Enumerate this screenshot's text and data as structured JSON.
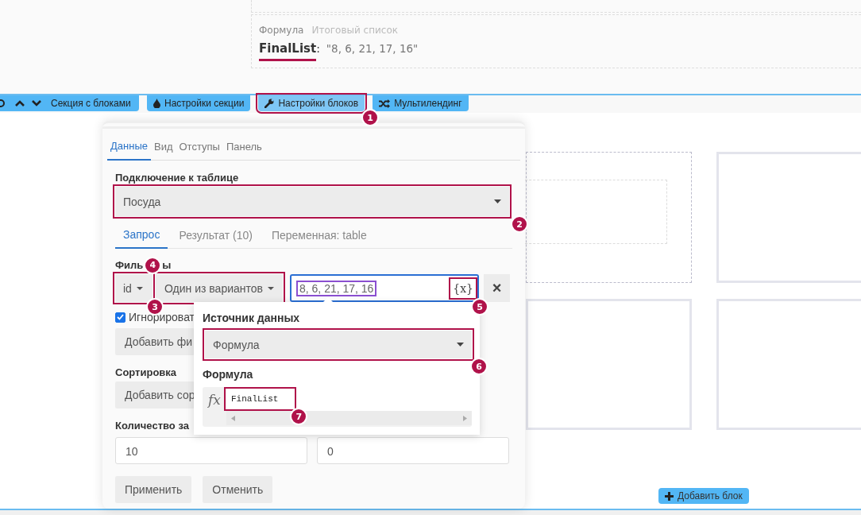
{
  "preview": {
    "source_label": "Формула",
    "title": "Итоговый список",
    "variable": "FinalList",
    "separator": ":",
    "value": "\"8, 6, 21, 17, 16\"",
    "underlined": true
  },
  "section_bar": {
    "label": "Секция с блоками"
  },
  "toolbar_buttons": [
    {
      "label": "Настройки секции"
    },
    {
      "label": "Настройки блоков",
      "callout": "1"
    },
    {
      "label": "Мультилендинг"
    }
  ],
  "panel": {
    "tabs": [
      {
        "label": "Данные",
        "selected": true
      },
      {
        "label": "Вид",
        "selected": false
      },
      {
        "label": "Отступы",
        "selected": false
      },
      {
        "label": "Панель",
        "selected": false
      }
    ],
    "connection": {
      "label": "Подключение к таблице",
      "value": "Посуда",
      "callout": "2"
    },
    "subtabs": [
      {
        "label": "Запрос",
        "selected": true
      },
      {
        "label": "Результат (10)",
        "selected": false
      },
      {
        "label": "Переменная: table",
        "selected": false
      }
    ],
    "filters": {
      "label_parts": [
        "Филь",
        "ы"
      ],
      "field": {
        "value": "id",
        "callout": "4"
      },
      "operator": {
        "value": "Один из вариантов",
        "callout": "3"
      },
      "value": {
        "value": "8, 6, 21, 17, 16",
        "marked": true
      },
      "variable_button": {
        "label": "{x}",
        "callout": "5"
      },
      "remove_button": "×",
      "ignore": {
        "label": "Игнорироват",
        "checked": true
      },
      "add_button": "Добавить фи"
    },
    "sorting": {
      "label": "Сортировка",
      "add_button": "Добавить сор"
    },
    "limit": {
      "label": "Количество за",
      "values": [
        "10",
        "0"
      ]
    },
    "buttons": [
      "Применить",
      "Отменить"
    ]
  },
  "popup": {
    "source_label": "Источник данных",
    "source": {
      "value": "Формула",
      "callout": "6"
    },
    "formula_label": "Формула",
    "fx_label": "fx",
    "formula": {
      "code": "FinalList",
      "callout": "7"
    }
  },
  "add_block_button": "Добавить блок"
}
